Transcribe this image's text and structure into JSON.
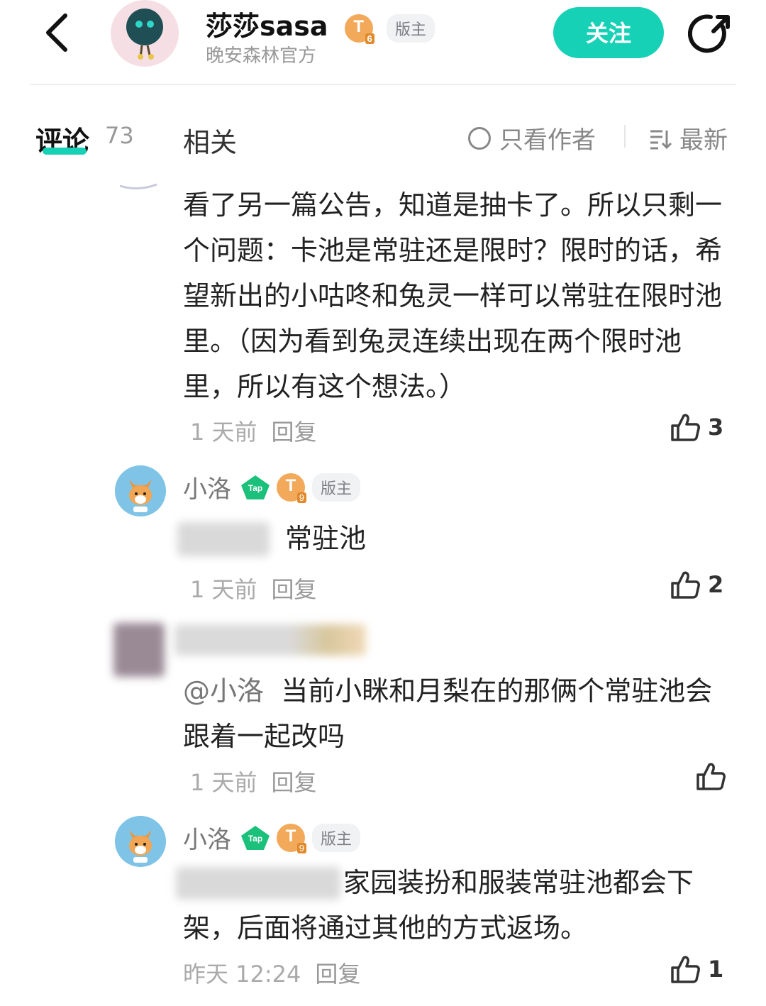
{
  "header": {
    "author_name": "莎莎sasa",
    "level_badge": "T",
    "level_num": "6",
    "role": "版主",
    "subtitle": "晚安森林官方",
    "follow_label": "关注",
    "icons": [
      "back-icon",
      "share-icon"
    ]
  },
  "tabs": {
    "comments_label": "评论",
    "comments_count": "73",
    "related_label": "相关",
    "only_author_label": "只看作者",
    "sort_label": "最新"
  },
  "comments": [
    {
      "body": "看了另一篇公告，知道是抽卡了。所以只剩一个问题：卡池是常驻还是限时？限时的话，希望新出的小咕咚和兔灵一样可以常驻在限时池里。（因为看到兔灵连续出现在两个限时池里，所以有这个想法。）",
      "time": "1 天前",
      "reply": "回复",
      "likes": "3"
    },
    {
      "name": "小洛",
      "tap_label": "Tap",
      "level_badge": "T",
      "level_num": "9",
      "role": "版主",
      "body": "常驻池",
      "time": "1 天前",
      "reply": "回复",
      "likes": "2"
    },
    {
      "mention": "@小洛",
      "body": "当前小眯和月梨在的那俩个常驻池会跟着一起改吗",
      "time": "1 天前",
      "reply": "回复",
      "likes": ""
    },
    {
      "name": "小洛",
      "tap_label": "Tap",
      "level_badge": "T",
      "level_num": "9",
      "role": "版主",
      "body": "家园装扮和服装常驻池都会下架，后面将通过其他的方式返场。",
      "time": "昨天 12:24",
      "reply": "回复",
      "likes": "1"
    }
  ],
  "colors": {
    "accent": "#17d1b6",
    "badge": "#f2a95a",
    "muted": "#999999"
  }
}
